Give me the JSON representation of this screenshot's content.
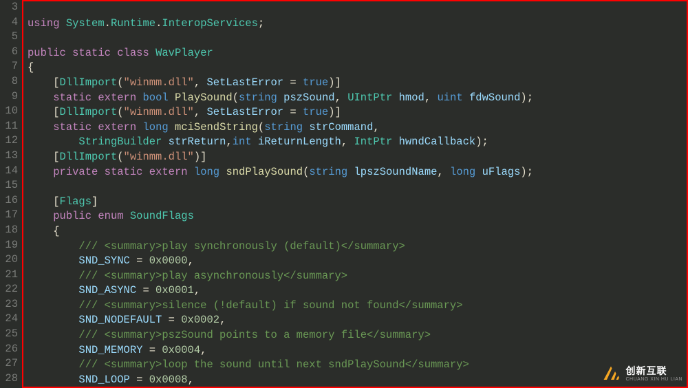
{
  "lines": [
    {
      "num": "3",
      "tokens": []
    },
    {
      "num": "4",
      "tokens": [
        {
          "c": "tok-kw",
          "t": "using"
        },
        {
          "t": " "
        },
        {
          "c": "tok-type",
          "t": "System"
        },
        {
          "t": "."
        },
        {
          "c": "tok-type",
          "t": "Runtime"
        },
        {
          "t": "."
        },
        {
          "c": "tok-type",
          "t": "InteropServices"
        },
        {
          "t": ";"
        }
      ]
    },
    {
      "num": "5",
      "tokens": []
    },
    {
      "num": "6",
      "tokens": [
        {
          "c": "tok-kw",
          "t": "public"
        },
        {
          "t": " "
        },
        {
          "c": "tok-kw",
          "t": "static"
        },
        {
          "t": " "
        },
        {
          "c": "tok-kw",
          "t": "class"
        },
        {
          "t": " "
        },
        {
          "c": "tok-type",
          "t": "WavPlayer"
        }
      ]
    },
    {
      "num": "7",
      "tokens": [
        {
          "t": "{"
        }
      ]
    },
    {
      "num": "8",
      "tokens": [
        {
          "t": "    ["
        },
        {
          "c": "tok-attr",
          "t": "DllImport"
        },
        {
          "t": "("
        },
        {
          "c": "tok-str",
          "t": "\"winmm.dll\""
        },
        {
          "t": ", "
        },
        {
          "c": "tok-prop",
          "t": "SetLastError"
        },
        {
          "t": " = "
        },
        {
          "c": "tok-const",
          "t": "true"
        },
        {
          "t": ")]"
        }
      ]
    },
    {
      "num": "9",
      "tokens": [
        {
          "t": "    "
        },
        {
          "c": "tok-kw",
          "t": "static"
        },
        {
          "t": " "
        },
        {
          "c": "tok-kw",
          "t": "extern"
        },
        {
          "t": " "
        },
        {
          "c": "tok-type2",
          "t": "bool"
        },
        {
          "t": " "
        },
        {
          "c": "tok-fn",
          "t": "PlaySound"
        },
        {
          "t": "("
        },
        {
          "c": "tok-type2",
          "t": "string"
        },
        {
          "t": " "
        },
        {
          "c": "tok-param",
          "t": "pszSound"
        },
        {
          "t": ", "
        },
        {
          "c": "tok-type",
          "t": "UIntPtr"
        },
        {
          "t": " "
        },
        {
          "c": "tok-param",
          "t": "hmod"
        },
        {
          "t": ", "
        },
        {
          "c": "tok-type2",
          "t": "uint"
        },
        {
          "t": " "
        },
        {
          "c": "tok-param",
          "t": "fdwSound"
        },
        {
          "t": ");"
        }
      ]
    },
    {
      "num": "10",
      "tokens": [
        {
          "t": "    ["
        },
        {
          "c": "tok-attr",
          "t": "DllImport"
        },
        {
          "t": "("
        },
        {
          "c": "tok-str",
          "t": "\"winmm.dll\""
        },
        {
          "t": ", "
        },
        {
          "c": "tok-prop",
          "t": "SetLastError"
        },
        {
          "t": " = "
        },
        {
          "c": "tok-const",
          "t": "true"
        },
        {
          "t": ")]"
        }
      ]
    },
    {
      "num": "11",
      "tokens": [
        {
          "t": "    "
        },
        {
          "c": "tok-kw",
          "t": "static"
        },
        {
          "t": " "
        },
        {
          "c": "tok-kw",
          "t": "extern"
        },
        {
          "t": " "
        },
        {
          "c": "tok-type2",
          "t": "long"
        },
        {
          "t": " "
        },
        {
          "c": "tok-fn",
          "t": "mciSendString"
        },
        {
          "t": "("
        },
        {
          "c": "tok-type2",
          "t": "string"
        },
        {
          "t": " "
        },
        {
          "c": "tok-param",
          "t": "strCommand"
        },
        {
          "t": ","
        }
      ]
    },
    {
      "num": "12",
      "tokens": [
        {
          "t": "        "
        },
        {
          "c": "tok-type",
          "t": "StringBuilder"
        },
        {
          "t": " "
        },
        {
          "c": "tok-param",
          "t": "strReturn"
        },
        {
          "t": ","
        },
        {
          "c": "tok-type2",
          "t": "int"
        },
        {
          "t": " "
        },
        {
          "c": "tok-param",
          "t": "iReturnLength"
        },
        {
          "t": ", "
        },
        {
          "c": "tok-type",
          "t": "IntPtr"
        },
        {
          "t": " "
        },
        {
          "c": "tok-param",
          "t": "hwndCallback"
        },
        {
          "t": ");"
        }
      ]
    },
    {
      "num": "13",
      "tokens": [
        {
          "t": "    ["
        },
        {
          "c": "tok-attr",
          "t": "DllImport"
        },
        {
          "t": "("
        },
        {
          "c": "tok-str",
          "t": "\"winmm.dll\""
        },
        {
          "t": ")]"
        }
      ]
    },
    {
      "num": "14",
      "tokens": [
        {
          "t": "    "
        },
        {
          "c": "tok-kw",
          "t": "private"
        },
        {
          "t": " "
        },
        {
          "c": "tok-kw",
          "t": "static"
        },
        {
          "t": " "
        },
        {
          "c": "tok-kw",
          "t": "extern"
        },
        {
          "t": " "
        },
        {
          "c": "tok-type2",
          "t": "long"
        },
        {
          "t": " "
        },
        {
          "c": "tok-fn",
          "t": "sndPlaySound"
        },
        {
          "t": "("
        },
        {
          "c": "tok-type2",
          "t": "string"
        },
        {
          "t": " "
        },
        {
          "c": "tok-param",
          "t": "lpszSoundName"
        },
        {
          "t": ", "
        },
        {
          "c": "tok-type2",
          "t": "long"
        },
        {
          "t": " "
        },
        {
          "c": "tok-param",
          "t": "uFlags"
        },
        {
          "t": ");"
        }
      ]
    },
    {
      "num": "15",
      "tokens": []
    },
    {
      "num": "16",
      "tokens": [
        {
          "t": "    ["
        },
        {
          "c": "tok-attr",
          "t": "Flags"
        },
        {
          "t": "]"
        }
      ]
    },
    {
      "num": "17",
      "tokens": [
        {
          "t": "    "
        },
        {
          "c": "tok-kw",
          "t": "public"
        },
        {
          "t": " "
        },
        {
          "c": "tok-kw",
          "t": "enum"
        },
        {
          "t": " "
        },
        {
          "c": "tok-type",
          "t": "SoundFlags"
        }
      ]
    },
    {
      "num": "18",
      "tokens": [
        {
          "t": "    {"
        }
      ]
    },
    {
      "num": "19",
      "tokens": [
        {
          "t": "        "
        },
        {
          "c": "tok-cmt",
          "t": "/// <summary>play synchronously (default)</summary>"
        }
      ]
    },
    {
      "num": "20",
      "tokens": [
        {
          "t": "        "
        },
        {
          "c": "tok-enum",
          "t": "SND_SYNC"
        },
        {
          "t": " = "
        },
        {
          "c": "tok-num",
          "t": "0x0000"
        },
        {
          "t": ","
        }
      ]
    },
    {
      "num": "21",
      "tokens": [
        {
          "t": "        "
        },
        {
          "c": "tok-cmt",
          "t": "/// <summary>play asynchronously</summary>"
        }
      ]
    },
    {
      "num": "22",
      "tokens": [
        {
          "t": "        "
        },
        {
          "c": "tok-enum",
          "t": "SND_ASYNC"
        },
        {
          "t": " = "
        },
        {
          "c": "tok-num",
          "t": "0x0001"
        },
        {
          "t": ","
        }
      ]
    },
    {
      "num": "23",
      "tokens": [
        {
          "t": "        "
        },
        {
          "c": "tok-cmt",
          "t": "/// <summary>silence (!default) if sound not found</summary>"
        }
      ]
    },
    {
      "num": "24",
      "tokens": [
        {
          "t": "        "
        },
        {
          "c": "tok-enum",
          "t": "SND_NODEFAULT"
        },
        {
          "t": " = "
        },
        {
          "c": "tok-num",
          "t": "0x0002"
        },
        {
          "t": ","
        }
      ]
    },
    {
      "num": "25",
      "tokens": [
        {
          "t": "        "
        },
        {
          "c": "tok-cmt",
          "t": "/// <summary>pszSound points to a memory file</summary>"
        }
      ]
    },
    {
      "num": "26",
      "tokens": [
        {
          "t": "        "
        },
        {
          "c": "tok-enum",
          "t": "SND_MEMORY"
        },
        {
          "t": " = "
        },
        {
          "c": "tok-num",
          "t": "0x0004"
        },
        {
          "t": ","
        }
      ]
    },
    {
      "num": "27",
      "tokens": [
        {
          "t": "        "
        },
        {
          "c": "tok-cmt",
          "t": "/// <summary>loop the sound until next sndPlaySound</summary>"
        }
      ]
    },
    {
      "num": "28",
      "tokens": [
        {
          "t": "        "
        },
        {
          "c": "tok-enum",
          "t": "SND_LOOP"
        },
        {
          "t": " = "
        },
        {
          "c": "tok-num",
          "t": "0x0008"
        },
        {
          "t": ","
        }
      ]
    }
  ],
  "watermark": {
    "main": "创新互联",
    "sub": "CHUANG XIN HU LIAN"
  }
}
